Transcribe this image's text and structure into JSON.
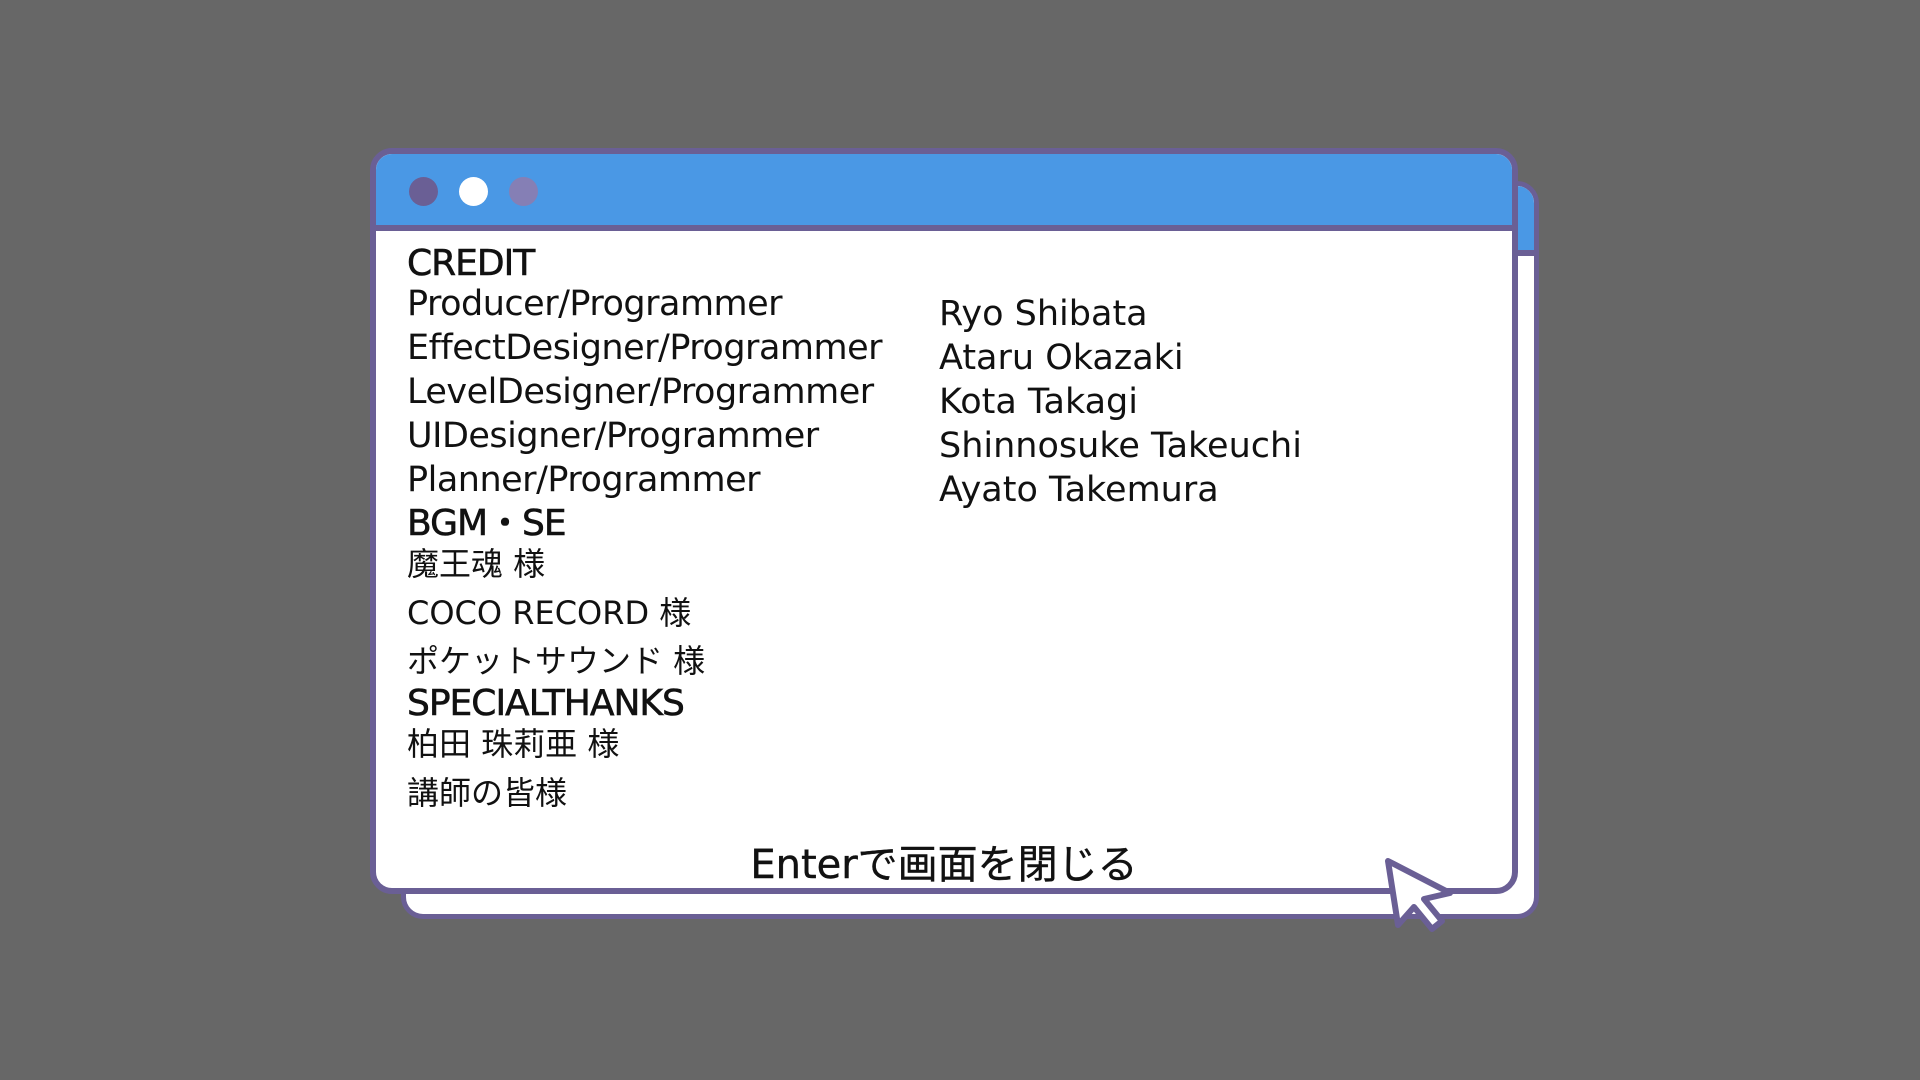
{
  "window": {
    "colors": {
      "background": "#676767",
      "title_bar": "#4a98e5",
      "border": "#6a5f95",
      "window_body": "#ffffff",
      "dot_close": "#6a5f95",
      "dot_minimize": "#ffffff",
      "dot_maximize": "#857fb5"
    }
  },
  "credits": {
    "title": "CREDIT",
    "roles": [
      "Producer/Programmer",
      "EffectDesigner/Programmer",
      "LevelDesigner/Programmer",
      "UIDesigner/Programmer",
      "Planner/Programmer"
    ],
    "names": [
      "Ryo Shibata",
      "Ataru Okazaki",
      "Kota Takagi",
      "Shinnosuke Takeuchi",
      "Ayato Takemura"
    ],
    "bgm_heading": "BGM・SE",
    "bgm_credits": [
      "魔王魂 様",
      "COCO RECORD 様",
      "ポケットサウンド 様"
    ],
    "thanks_heading": "SPECIALTHANKS",
    "thanks": [
      "柏田 珠莉亜 様",
      "講師の皆様"
    ]
  },
  "footer": {
    "close_hint": "Enterで画面を閉じる"
  },
  "icons": {
    "cursor": "mouse-pointer-icon"
  }
}
